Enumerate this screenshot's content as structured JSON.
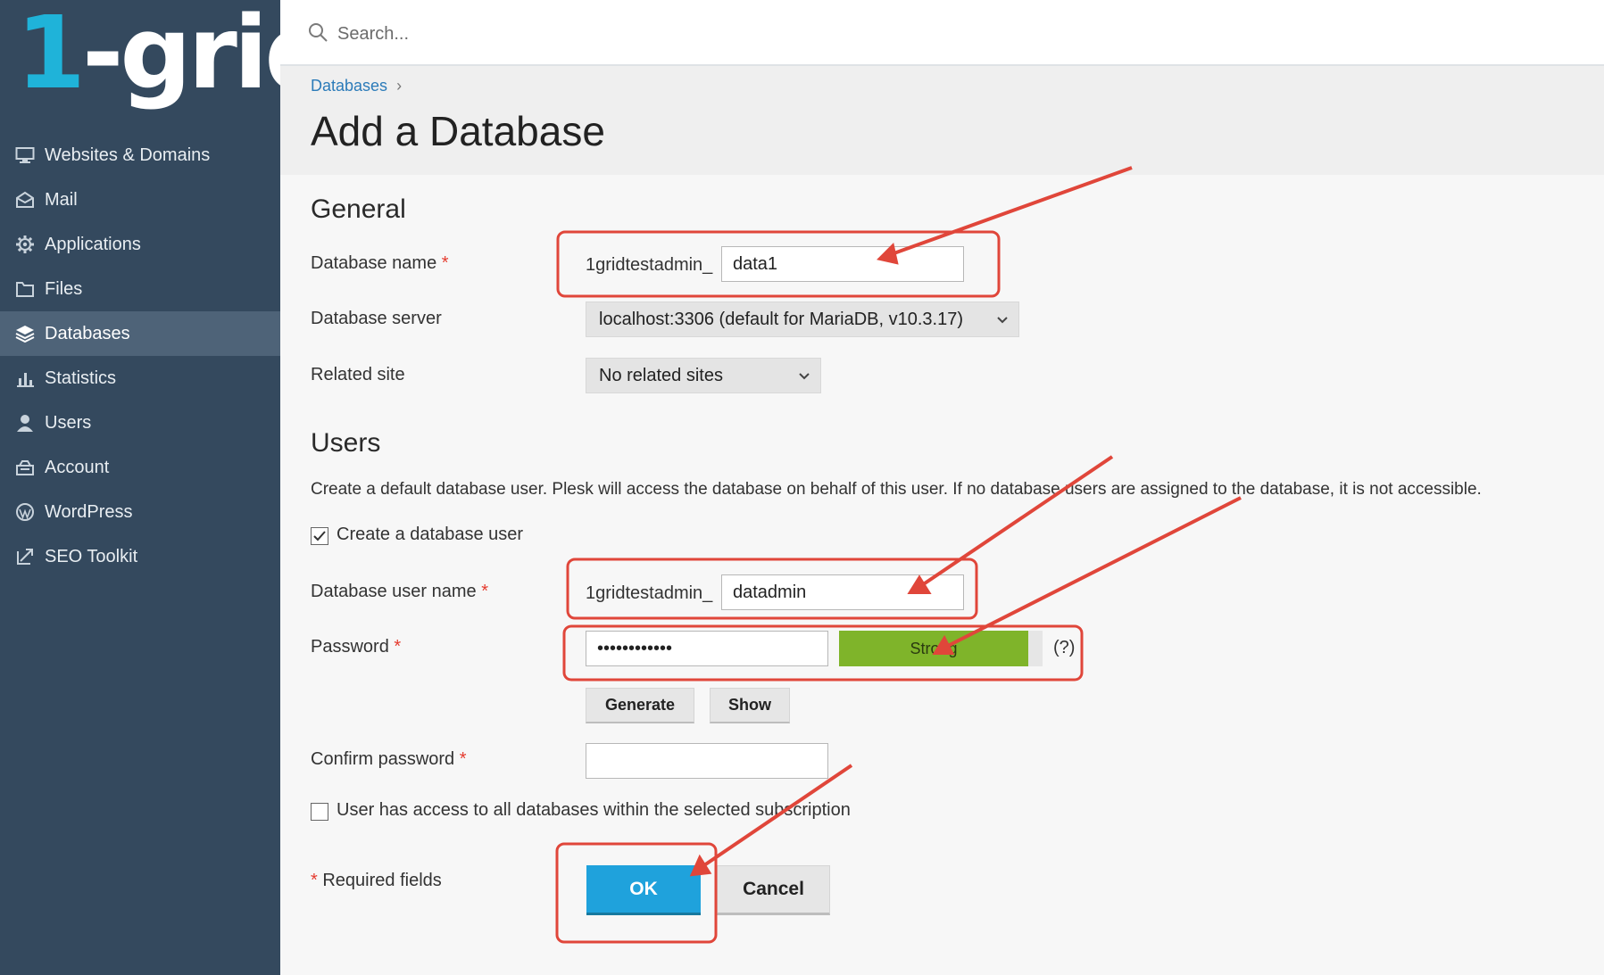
{
  "app": {
    "logo_text_one": "1",
    "logo_text_rest": "-grid",
    "accent_color": "#1fb3d9",
    "sidebar_color": "#34495e",
    "annotation_color": "#e0463a"
  },
  "search": {
    "placeholder": "Search..."
  },
  "sidebar": {
    "items": [
      {
        "label": "Websites & Domains",
        "icon": "monitor-icon"
      },
      {
        "label": "Mail",
        "icon": "mail-icon"
      },
      {
        "label": "Applications",
        "icon": "gear-icon"
      },
      {
        "label": "Files",
        "icon": "folder-icon"
      },
      {
        "label": "Databases",
        "icon": "database-icon",
        "active": true
      },
      {
        "label": "Statistics",
        "icon": "bar-chart-icon"
      },
      {
        "label": "Users",
        "icon": "user-icon"
      },
      {
        "label": "Account",
        "icon": "account-icon"
      },
      {
        "label": "WordPress",
        "icon": "wordpress-icon"
      },
      {
        "label": "SEO Toolkit",
        "icon": "seo-icon"
      }
    ],
    "collapse_glyph": "‹"
  },
  "header": {
    "breadcrumb": "Databases",
    "breadcrumb_sep": "›",
    "title": "Add a Database"
  },
  "general": {
    "title": "General",
    "db_name_label": "Database name",
    "required_mark": "*",
    "db_name_prefix": "1gridtestadmin_",
    "db_name_value": "data1",
    "db_server_label": "Database server",
    "db_server_value": "localhost:3306 (default for MariaDB, v10.3.17)",
    "related_site_label": "Related site",
    "related_site_value": "No related sites"
  },
  "users": {
    "title": "Users",
    "description": "Create a default database user. Plesk will access the database on behalf of this user. If no database users are assigned to the database, it is not accessible.",
    "create_user_label": "Create a database user",
    "create_user_checked": true,
    "user_name_label": "Database user name",
    "user_name_prefix": "1gridtestadmin_",
    "user_name_value": "datadmin",
    "password_label": "Password",
    "password_value": "••••••••••••",
    "strength_label": "Strong",
    "help_label": "(?)",
    "generate_label": "Generate",
    "show_label": "Show",
    "confirm_label": "Confirm password",
    "confirm_value": "",
    "access_all_label": "User has access to all databases within the selected subscription",
    "access_all_checked": false
  },
  "footer": {
    "required_note": "Required fields",
    "ok_label": "OK",
    "cancel_label": "Cancel"
  }
}
